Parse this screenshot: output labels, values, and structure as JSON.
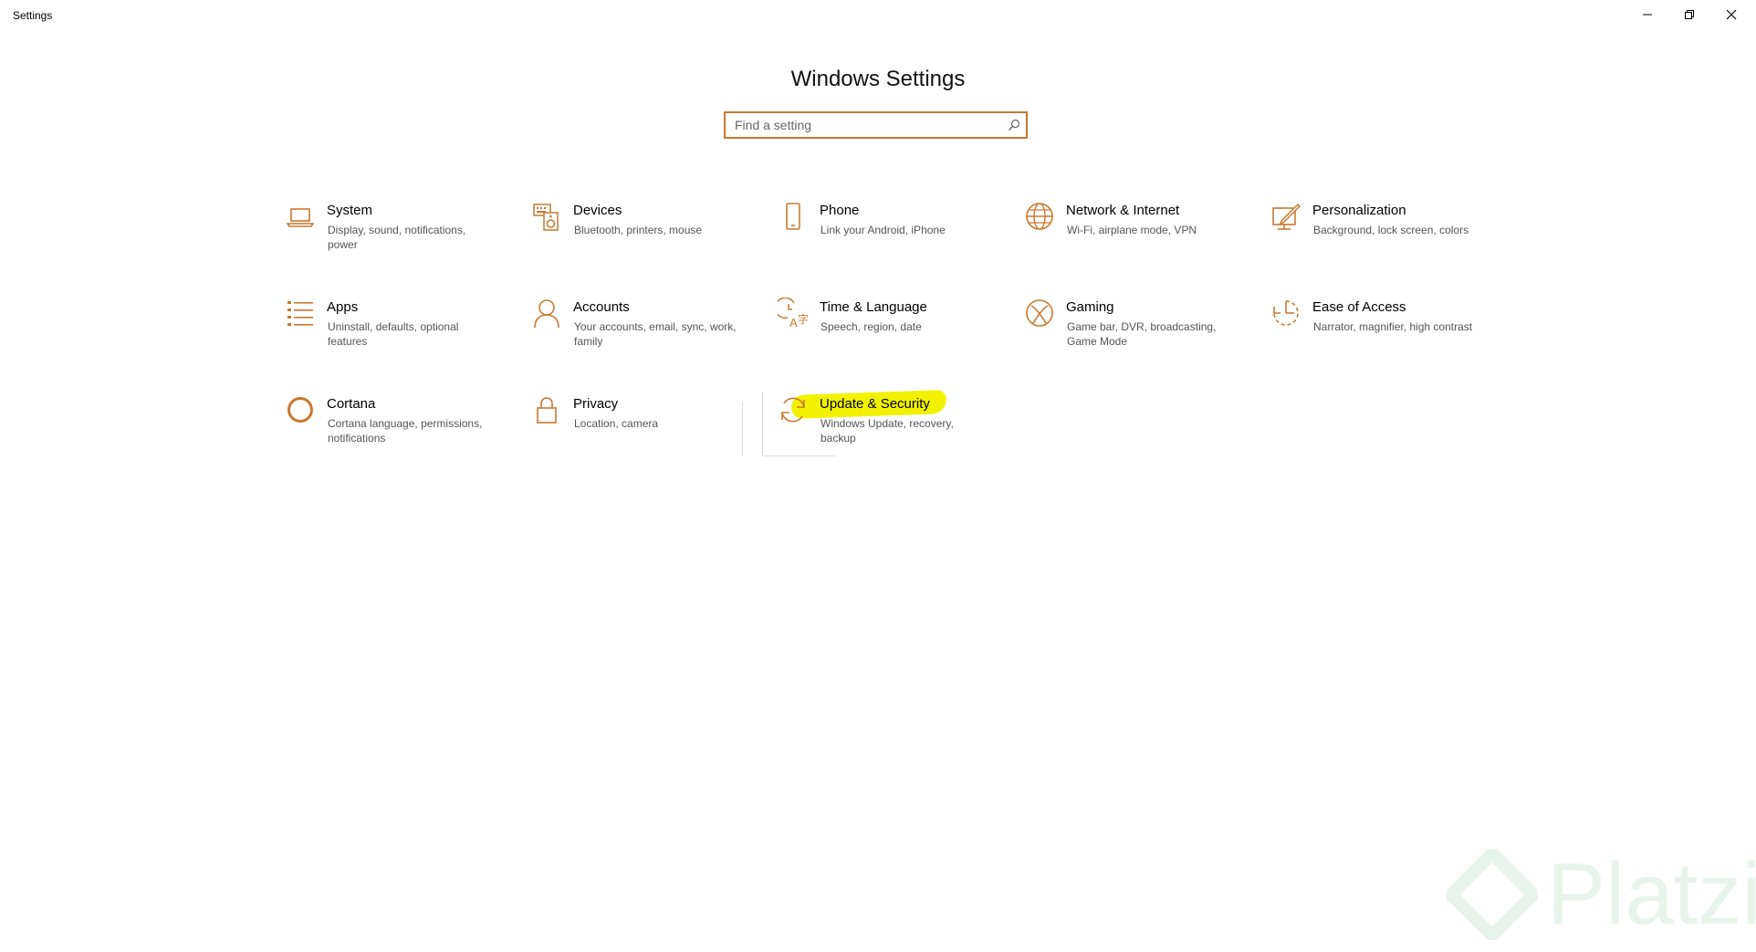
{
  "window": {
    "app_title": "Settings",
    "controls": [
      "minimize",
      "restore",
      "close"
    ]
  },
  "main": {
    "title": "Windows Settings",
    "search_placeholder": "Find a setting"
  },
  "accent_color": "#c9782f",
  "tiles": [
    {
      "name": "System",
      "desc": "Display, sound, notifications, power",
      "icon": "laptop-icon"
    },
    {
      "name": "Devices",
      "desc": "Bluetooth, printers, mouse",
      "icon": "keyboard-speaker-icon"
    },
    {
      "name": "Phone",
      "desc": "Link your Android, iPhone",
      "icon": "phone-icon"
    },
    {
      "name": "Network & Internet",
      "desc": "Wi-Fi, airplane mode, VPN",
      "icon": "globe-icon"
    },
    {
      "name": "Personalization",
      "desc": "Background, lock screen, colors",
      "icon": "paint-pen-icon"
    },
    {
      "name": "Apps",
      "desc": "Uninstall, defaults, optional features",
      "icon": "app-list-icon"
    },
    {
      "name": "Accounts",
      "desc": "Your accounts, email, sync, work, family",
      "icon": "person-icon"
    },
    {
      "name": "Time & Language",
      "desc": "Speech, region, date",
      "icon": "time-language-icon"
    },
    {
      "name": "Gaming",
      "desc": "Game bar, DVR, broadcasting, Game Mode",
      "icon": "xbox-icon"
    },
    {
      "name": "Ease of Access",
      "desc": "Narrator, magnifier, high contrast",
      "icon": "ease-of-access-icon"
    },
    {
      "name": "Cortana",
      "desc": "Cortana language, permissions, notifications",
      "icon": "cortana-ring-icon"
    },
    {
      "name": "Privacy",
      "desc": "Location, camera",
      "icon": "lock-icon"
    },
    {
      "name": "Update & Security",
      "desc": "Windows Update, recovery, backup",
      "icon": "sync-arrows-icon",
      "highlight_color": "#f2f200"
    }
  ],
  "watermark": {
    "text": "Platzi"
  }
}
